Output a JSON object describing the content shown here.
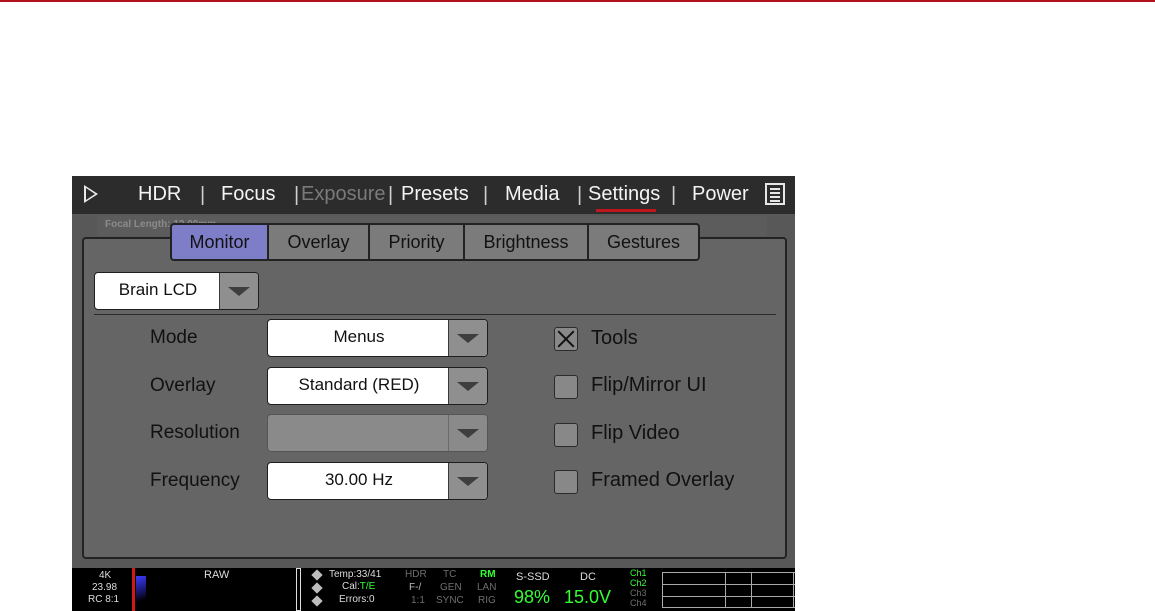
{
  "nav": {
    "items": [
      "HDR",
      "Focus",
      "Exposure",
      "Presets",
      "Media",
      "Settings",
      "Power"
    ],
    "active": "Settings",
    "disabled": "Exposure"
  },
  "background_label": "Focal Length: 12.00mm",
  "tabs": [
    "Monitor",
    "Overlay",
    "Priority",
    "Brightness",
    "Gestures"
  ],
  "active_tab": "Monitor",
  "monitor_select": "Brain LCD",
  "fields": [
    {
      "label": "Mode",
      "value": "Menus"
    },
    {
      "label": "Overlay",
      "value": "Standard (RED)"
    },
    {
      "label": "Resolution",
      "value": ""
    },
    {
      "label": "Frequency",
      "value": "30.00 Hz"
    }
  ],
  "checkboxes": [
    {
      "label": "Tools",
      "checked": true
    },
    {
      "label": "Flip/Mirror UI",
      "checked": false
    },
    {
      "label": "Flip Video",
      "checked": false
    },
    {
      "label": "Framed Overlay",
      "checked": false
    }
  ],
  "status": {
    "format": "4K",
    "fps": "23.98",
    "compression": "RC 8:1",
    "codec": "RAW",
    "temp": "Temp:33/41",
    "cal_prefix": "Cal:",
    "cal_value": "T/E",
    "errors": "Errors:0",
    "hdr": "HDR",
    "tc": "TC",
    "rm": "RM",
    "f": "F-/",
    "gen": "GEN",
    "lan": "LAN",
    "ratio": "1:1",
    "sync": "SYNC",
    "rig": "RIG",
    "media_label": "S-SSD",
    "media_value": "98%",
    "power_label": "DC",
    "power_value": "15.0V",
    "channels": [
      "Ch1",
      "Ch2",
      "Ch3",
      "Ch4"
    ]
  },
  "colors": {
    "accent_red": "#c0151d",
    "active_tab": "#7e7ec8",
    "status_green": "#33ff33"
  }
}
